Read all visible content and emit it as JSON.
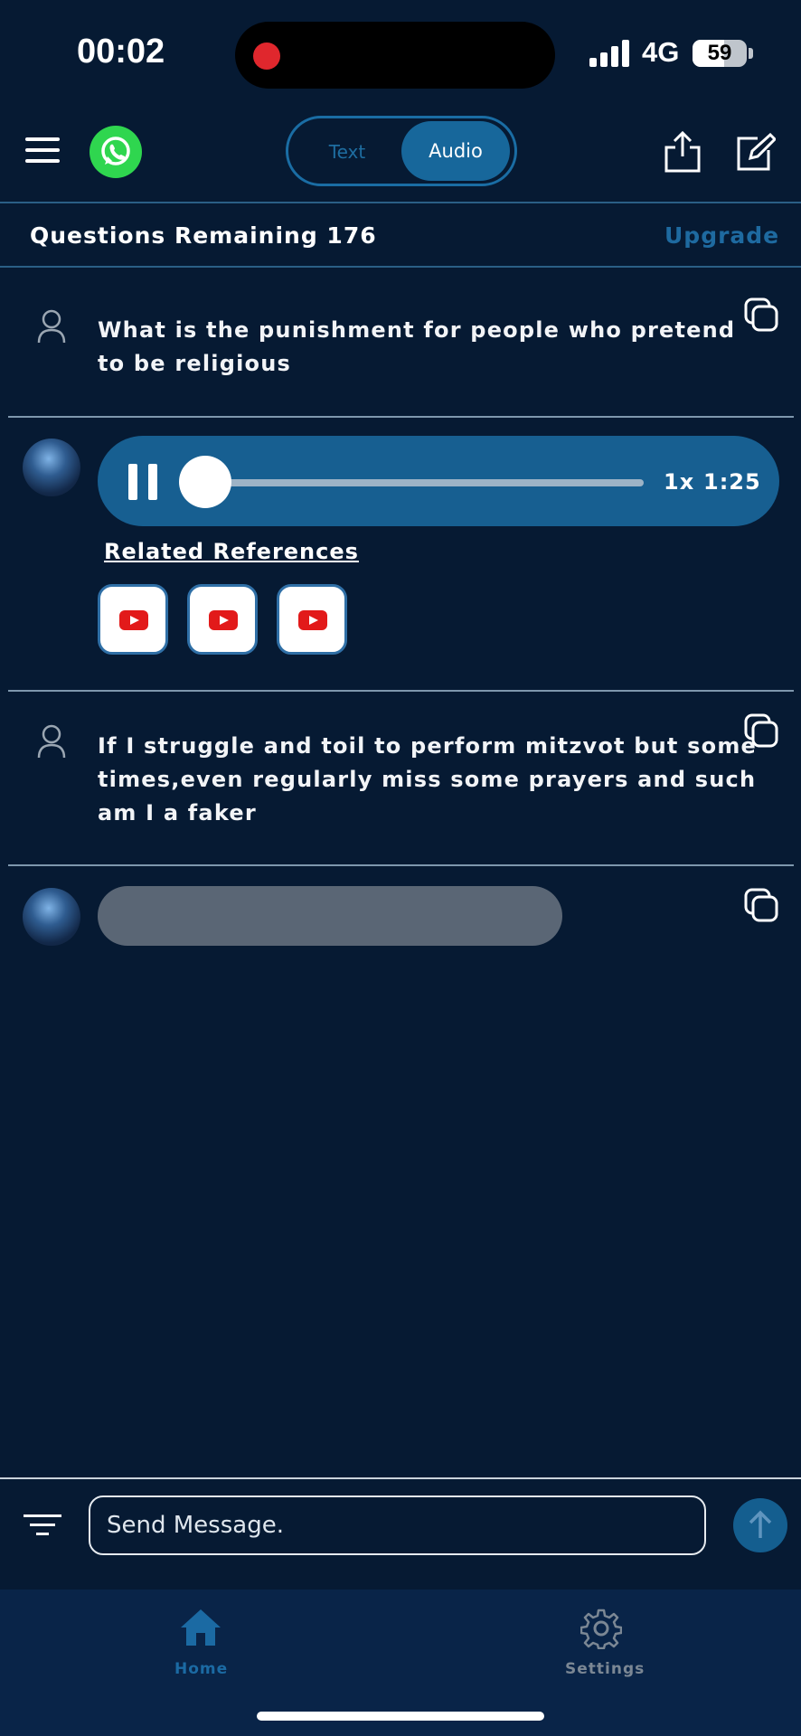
{
  "status_bar": {
    "time": "00:02",
    "network": "4G",
    "battery": 59
  },
  "header": {
    "mode_options": [
      "Text",
      "Audio"
    ],
    "selected_mode": "Audio",
    "questions_remaining_label": "Questions Remaining 176",
    "upgrade_label": "Upgrade"
  },
  "chat": {
    "messages": [
      {
        "role": "user",
        "text": "What is the punishment for people who pretend to be religious"
      },
      {
        "role": "assistant",
        "type": "audio",
        "playing": true,
        "progress": 0.0,
        "speed": "1x",
        "duration": "1:25",
        "related_label": "Related References",
        "references": [
          "youtube",
          "youtube",
          "youtube"
        ]
      },
      {
        "role": "user",
        "text": "If I struggle and toil to perform mitzvot but some times,even regularly miss some prayers and such am I a faker"
      },
      {
        "role": "assistant",
        "type": "loading"
      }
    ]
  },
  "composer": {
    "placeholder": "Send Message."
  },
  "tabs": [
    {
      "label": "Home",
      "active": true,
      "color": "#1b6aa3"
    },
    {
      "label": "Settings",
      "active": false,
      "color": "#7b8794"
    }
  ],
  "colors": {
    "background": "#061a33",
    "accent": "#17679b",
    "whatsapp": "#2fd64f",
    "record": "#e0272d",
    "youtube": "#e21a1a"
  }
}
